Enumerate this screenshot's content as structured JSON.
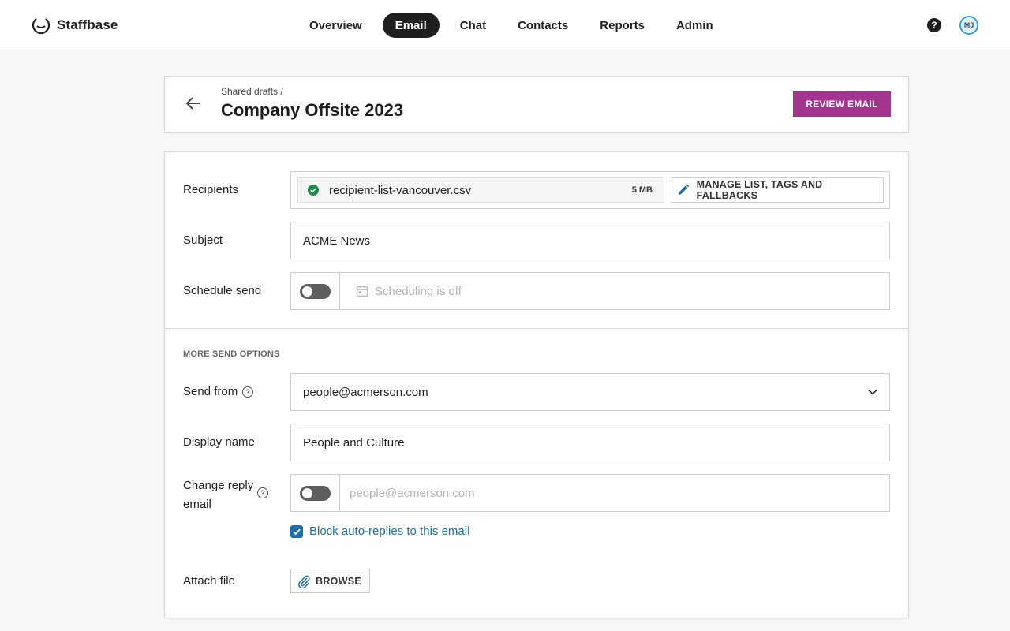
{
  "brand": {
    "name": "Staffbase"
  },
  "nav": {
    "items": [
      {
        "label": "Overview",
        "active": false
      },
      {
        "label": "Email",
        "active": true
      },
      {
        "label": "Chat",
        "active": false
      },
      {
        "label": "Contacts",
        "active": false
      },
      {
        "label": "Reports",
        "active": false
      },
      {
        "label": "Admin",
        "active": false
      }
    ],
    "help_glyph": "?",
    "avatar_initials": "MJ"
  },
  "header": {
    "breadcrumb": "Shared drafts /",
    "title": "Company Offsite 2023",
    "review_label": "REVIEW EMAIL"
  },
  "form": {
    "recipients": {
      "label": "Recipients",
      "file_name": "recipient-list-vancouver.csv",
      "file_size": "5 MB",
      "manage_label": "MANAGE LIST, TAGS AND FALLBACKS"
    },
    "subject": {
      "label": "Subject",
      "value": "ACME News"
    },
    "schedule": {
      "label": "Schedule send",
      "enabled": false,
      "placeholder": "Scheduling is off"
    },
    "more_options_title": "MORE SEND OPTIONS",
    "send_from": {
      "label": "Send from",
      "value": "people@acmerson.com"
    },
    "display_name": {
      "label": "Display name",
      "value": "People and Culture"
    },
    "reply_email": {
      "label_line1": "Change reply",
      "label_line2": "email",
      "enabled": false,
      "placeholder": "people@acmerson.com"
    },
    "block_auto_replies": {
      "label": "Block auto-replies to this email",
      "checked": true
    },
    "attach": {
      "label": "Attach file",
      "browse_label": "BROWSE"
    }
  },
  "colors": {
    "accent": "#a3358f",
    "link": "#1b6fae",
    "success": "#1e8a4c"
  }
}
